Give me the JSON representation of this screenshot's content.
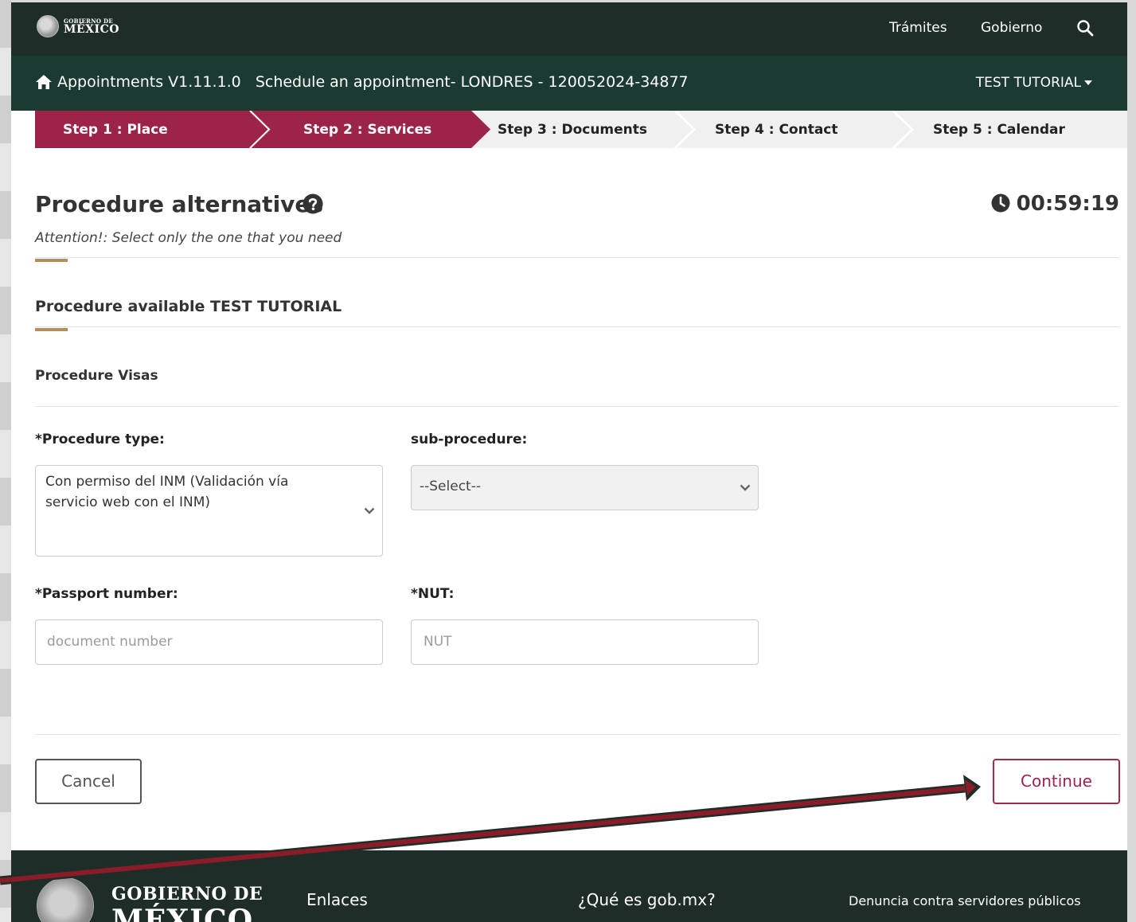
{
  "colors": {
    "nav_dark": "#1e2d27",
    "nav_green": "#1b3a31",
    "step_active": "#9d2449",
    "step_inactive": "#f0f0f0",
    "accent_gold": "#b38e5d",
    "continue_border": "#9d2449"
  },
  "topnav": {
    "logo_small": "GOBIERNO DE",
    "logo_big": "MÉXICO",
    "links": [
      "Trámites",
      "Gobierno"
    ],
    "search_icon": "search-icon"
  },
  "subnav": {
    "home_icon": "home-icon",
    "title": "Appointments V1.11.1.0   Schedule an appointment- LONDRES - 120052024-34877",
    "user": "TEST TUTORIAL"
  },
  "steps": [
    {
      "label": "Step 1 : Place",
      "state": "done"
    },
    {
      "label": "Step 2 : Services",
      "state": "active"
    },
    {
      "label": "Step 3 : Documents",
      "state": "pending"
    },
    {
      "label": "Step 4 : Contact",
      "state": "pending"
    },
    {
      "label": "Step 5 : Calendar",
      "state": "pending"
    }
  ],
  "main": {
    "title": "Procedure alternatives",
    "help_icon": "question-circle-icon",
    "timer": "00:59:19",
    "attention": "Attention!: Select only the one that you need",
    "section_title": "Procedure available TEST TUTORIAL",
    "subsection": "Procedure Visas"
  },
  "form": {
    "procedure_type_label": "*Procedure type:",
    "procedure_type_value": "Con permiso del INM (Validación vía servicio web con el INM)",
    "subprocedure_label": "sub-procedure:",
    "subprocedure_value": "--Select--",
    "passport_label": "*Passport number:",
    "passport_placeholder": "document number",
    "nut_label": "*NUT:",
    "nut_placeholder": "NUT"
  },
  "buttons": {
    "cancel": "Cancel",
    "continue": "Continue"
  },
  "footer": {
    "logo_line1": "GOBIERNO DE",
    "logo_line2": "MÉXICO",
    "links": [
      "Enlaces",
      "¿Qué es gob.mx?"
    ],
    "small_link": "Denuncia contra servidores públicos"
  }
}
